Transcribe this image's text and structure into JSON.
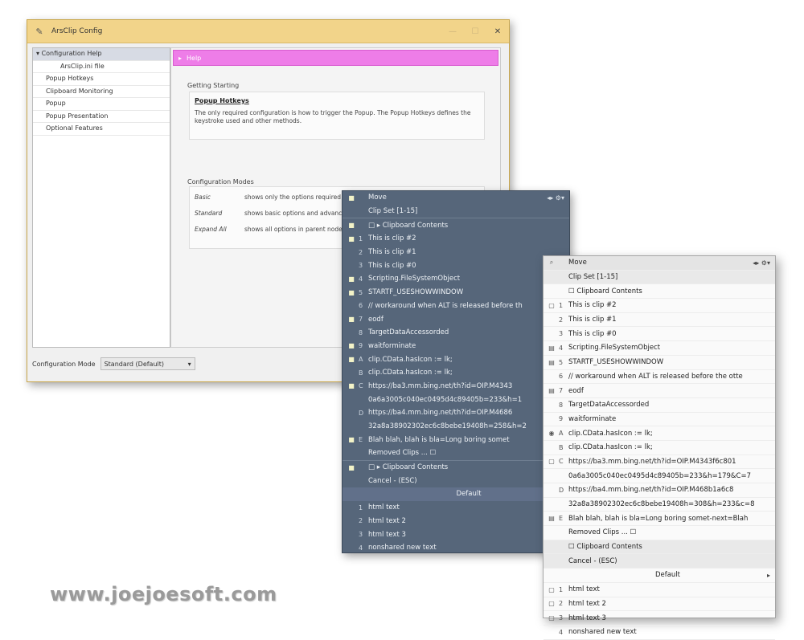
{
  "config_window": {
    "title": "ArsClip Config",
    "controls": {
      "minimize": "—",
      "maximize": "☐",
      "close": "✕"
    },
    "tree": [
      {
        "label": "Configuration Help",
        "selected": true
      },
      {
        "label": "ArsClip.ini file",
        "child": true
      },
      {
        "label": "Popup Hotkeys"
      },
      {
        "label": "Clipboard Monitoring"
      },
      {
        "label": "Popup"
      },
      {
        "label": "Popup Presentation"
      },
      {
        "label": "Optional Features"
      }
    ],
    "panel_header": "Help",
    "getting_started": {
      "label": "Getting Starting",
      "heading": "Popup Hotkeys",
      "text": "The only required configuration is how to trigger the Popup. The Popup Hotkeys defines the keystroke used and other methods."
    },
    "config_modes": {
      "label": "Configuration Modes",
      "rows": [
        {
          "key": "Basic",
          "value": "shows only the options required for basic operation"
        },
        {
          "key": "Standard",
          "value": "shows basic options and advanced options are optional"
        },
        {
          "key": "Expand All",
          "value": "shows all options in parent nodes"
        }
      ]
    },
    "footer": {
      "label": "Configuration Mode",
      "value": "Standard (Default)",
      "arrow": "▾"
    }
  },
  "dark_menu": {
    "rows": [
      {
        "icon": "■",
        "num": "",
        "text": "Move",
        "right": "◂▸ ⚙▾",
        "cls": "top"
      },
      {
        "icon": "",
        "num": "",
        "text": "Clip Set   [1-15]",
        "cls": "sep"
      },
      {
        "icon": "■",
        "num": "",
        "text": "□ ▸ Clipboard Contents"
      },
      {
        "icon": "■",
        "num": "1",
        "text": "This is clip #2"
      },
      {
        "icon": "",
        "num": "2",
        "text": "This is clip #1"
      },
      {
        "icon": "",
        "num": "3",
        "text": "This is clip #0"
      },
      {
        "icon": "■",
        "num": "4",
        "text": "Scripting.FileSystemObject"
      },
      {
        "icon": "■",
        "num": "5",
        "text": "STARTF_USESHOWWINDOW"
      },
      {
        "icon": "",
        "num": "6",
        "text": "// workaround when ALT is released before th"
      },
      {
        "icon": "■",
        "num": "7",
        "text": "eodf"
      },
      {
        "icon": "",
        "num": "8",
        "text": "TargetDataAccessorded"
      },
      {
        "icon": "■",
        "num": "9",
        "text": "waitforminate"
      },
      {
        "icon": "■",
        "num": "A",
        "text": "clip.CData.hasIcon := lk;"
      },
      {
        "icon": "",
        "num": "B",
        "text": "clip.CData.hasIcon := lk;"
      },
      {
        "icon": "■",
        "num": "C",
        "text": "https://ba3.mm.bing.net/th?id=OIP.M4343"
      },
      {
        "icon": "",
        "num": "",
        "text": "0a6a3005c040ec0495d4c89405b=233&h=1"
      },
      {
        "icon": "",
        "num": "D",
        "text": "https://ba4.mm.bing.net/th?id=OIP.M4686"
      },
      {
        "icon": "",
        "num": "",
        "text": "32a8a38902302ec6c8bebe19408h=258&h=2"
      },
      {
        "icon": "■",
        "num": "E",
        "text": "Blah blah, blah is bla=Long boring somet"
      },
      {
        "icon": "",
        "num": "",
        "text": "Removed Clips ... ☐",
        "cls": "sep"
      },
      {
        "icon": "■",
        "num": "",
        "text": "□ ▸ Clipboard Contents"
      },
      {
        "icon": "",
        "num": "",
        "text": "Cancel - (ESC)"
      },
      {
        "icon": "",
        "num": "",
        "text": "Default",
        "cls": "center ddefault"
      },
      {
        "icon": "",
        "num": "1",
        "text": "html text"
      },
      {
        "icon": "",
        "num": "2",
        "text": "html text 2"
      },
      {
        "icon": "",
        "num": "3",
        "text": "html text 3"
      },
      {
        "icon": "",
        "num": "4",
        "text": "nonshared new text"
      }
    ]
  },
  "light_menu": {
    "rows": [
      {
        "icon": "⌕",
        "num": "",
        "text": "Move",
        "right": "◂▸ ⚙▾",
        "cls": "top"
      },
      {
        "icon": "",
        "num": "",
        "text": "Clip Set   [1-15]",
        "cls": "grey"
      },
      {
        "icon": "",
        "num": "",
        "text": "☐ Clipboard Contents"
      },
      {
        "icon": "▢",
        "num": "1",
        "text": "This is clip #2"
      },
      {
        "icon": "",
        "num": "2",
        "text": "This is clip #1"
      },
      {
        "icon": "",
        "num": "3",
        "text": "This is clip #0"
      },
      {
        "icon": "▤",
        "num": "4",
        "text": "Scripting.FileSystemObject"
      },
      {
        "icon": "▤",
        "num": "5",
        "text": "STARTF_USESHOWWINDOW"
      },
      {
        "icon": "",
        "num": "6",
        "text": "// workaround when ALT is released before the otte"
      },
      {
        "icon": "▤",
        "num": "7",
        "text": "eodf"
      },
      {
        "icon": "",
        "num": "8",
        "text": "TargetDataAccessorded"
      },
      {
        "icon": "",
        "num": "9",
        "text": "waitforminate"
      },
      {
        "icon": "◉",
        "num": "A",
        "text": "clip.CData.hasIcon := lk;"
      },
      {
        "icon": "",
        "num": "B",
        "text": "clip.CData.hasIcon := lk;"
      },
      {
        "icon": "▢",
        "num": "C",
        "text": "https://ba3.mm.bing.net/th?id=OIP.M4343f6c801"
      },
      {
        "icon": "",
        "num": "",
        "text": "0a6a3005c040ec0495d4c89405b=233&h=179&C=7"
      },
      {
        "icon": "",
        "num": "D",
        "text": "https://ba4.mm.bing.net/th?id=OIP.M468b1a6c8"
      },
      {
        "icon": "",
        "num": "",
        "text": "32a8a38902302ec6c8bebe19408h=308&h=233&c=8"
      },
      {
        "icon": "▤",
        "num": "E",
        "text": "Blah blah, blah is bla=Long boring somet-next=Blah"
      },
      {
        "icon": "",
        "num": "",
        "text": "Removed Clips ... ☐"
      },
      {
        "icon": "",
        "num": "",
        "text": "☐ Clipboard Contents",
        "cls": "grey"
      },
      {
        "icon": "",
        "num": "",
        "text": "Cancel - (ESC)",
        "cls": "grey"
      },
      {
        "icon": "",
        "num": "",
        "text": "Default",
        "right": "▸",
        "cls": "center"
      },
      {
        "icon": "▢",
        "num": "1",
        "text": "html text"
      },
      {
        "icon": "▢",
        "num": "2",
        "text": "html text 2"
      },
      {
        "icon": "▢",
        "num": "3",
        "text": "html text 3"
      },
      {
        "icon": "",
        "num": "4",
        "text": "nonshared new text"
      }
    ]
  },
  "watermark": "www.joejoesoft.com"
}
